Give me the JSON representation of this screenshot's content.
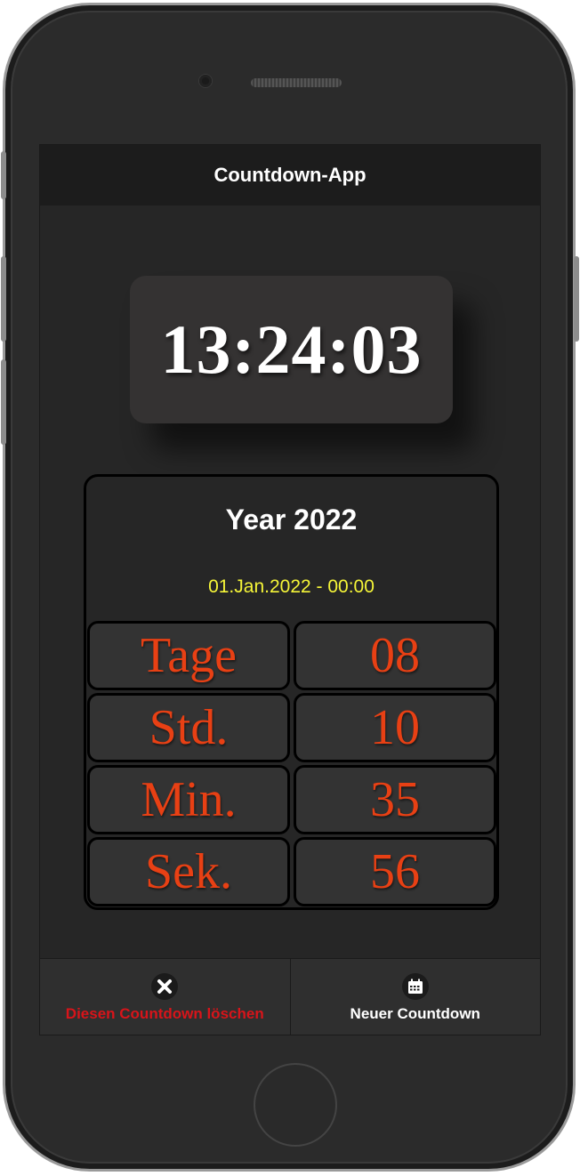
{
  "app": {
    "title": "Countdown-App"
  },
  "clock": {
    "time": "13:24:03"
  },
  "countdown": {
    "title": "Year 2022",
    "target_date": "01.Jan.2022 - 00:00",
    "rows": [
      {
        "label": "Tage",
        "value": "08"
      },
      {
        "label": "Std.",
        "value": "10"
      },
      {
        "label": "Min.",
        "value": "35"
      },
      {
        "label": "Sek.",
        "value": "56"
      }
    ]
  },
  "footer": {
    "delete_label": "Diesen Countdown löschen",
    "delete_icon": "close-circle-icon",
    "new_label": "Neuer Countdown",
    "new_icon": "calendar-icon"
  },
  "colors": {
    "background": "#262626",
    "countdown_text": "#e84014",
    "date_text": "#f5f538",
    "delete_text": "#d8141a"
  }
}
